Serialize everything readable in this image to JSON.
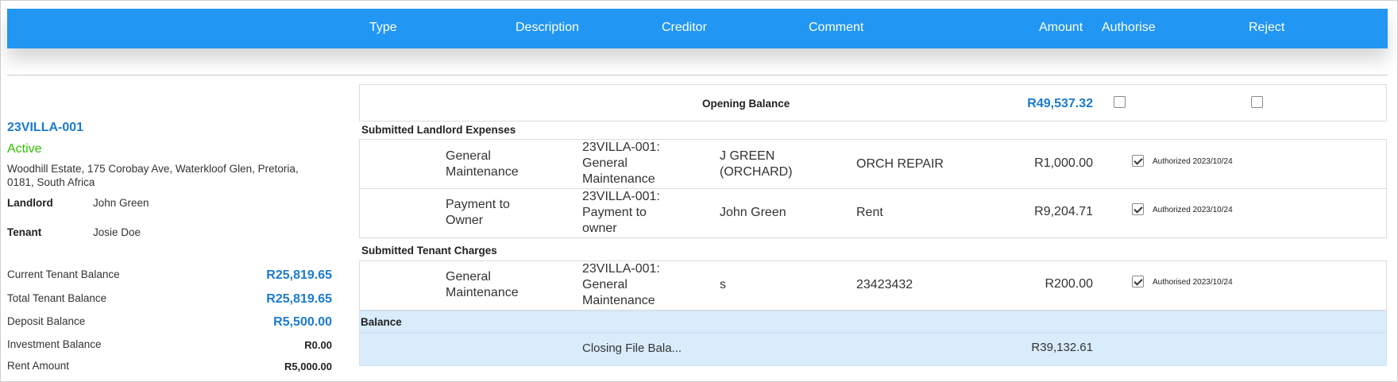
{
  "header": {
    "columns": {
      "type": "Type",
      "description": "Description",
      "creditor": "Creditor",
      "comment": "Comment",
      "amount": "Amount",
      "authorise": "Authorise",
      "reject": "Reject"
    }
  },
  "property": {
    "code": "23VILLA-001",
    "status": "Active",
    "address": "Woodhill Estate, 175 Corobay Ave, Waterkloof Glen, Pretoria, 0181, South Africa",
    "landlord_label": "Landlord",
    "landlord": "John Green",
    "tenant_label": "Tenant",
    "tenant": "Josie Doe"
  },
  "balances": [
    {
      "label": "Current Tenant Balance",
      "value": "R25,819.65"
    },
    {
      "label": "Total Tenant Balance",
      "value": "R25,819.65"
    },
    {
      "label": "Deposit Balance",
      "value": "R5,500.00"
    },
    {
      "label": "Investment Balance",
      "value": "R0.00"
    },
    {
      "label": "Rent Amount",
      "value": "R5,000.00"
    }
  ],
  "opening": {
    "label": "Opening Balance",
    "amount": "R49,537.32",
    "authorise_checked": false,
    "reject_checked": false
  },
  "landlord_expenses": {
    "title": "Submitted Landlord Expenses",
    "rows": [
      {
        "type": "General Maintenance",
        "description": "23VILLA-001: General Maintenance",
        "creditor": "J GREEN (ORCHARD)",
        "comment": "ORCH REPAIR",
        "amount": "R1,000.00",
        "checked": true,
        "status": "Authorized 2023/10/24"
      },
      {
        "type": "Payment to Owner",
        "description": "23VILLA-001: Payment to owner",
        "creditor": "John Green",
        "comment": "Rent",
        "amount": "R9,204.71",
        "checked": true,
        "status": "Authorized 2023/10/24"
      }
    ]
  },
  "tenant_charges": {
    "title": "Submitted Tenant Charges",
    "rows": [
      {
        "type": "General Maintenance",
        "description": "23VILLA-001: General Maintenance",
        "creditor": "s",
        "comment": "23423432",
        "amount": "R200.00",
        "checked": true,
        "status": "Authorised 2023/10/24"
      }
    ]
  },
  "balance_section": {
    "title": "Balance",
    "closing_label": "Closing File Bala...",
    "closing_amount": "R39,132.61"
  }
}
